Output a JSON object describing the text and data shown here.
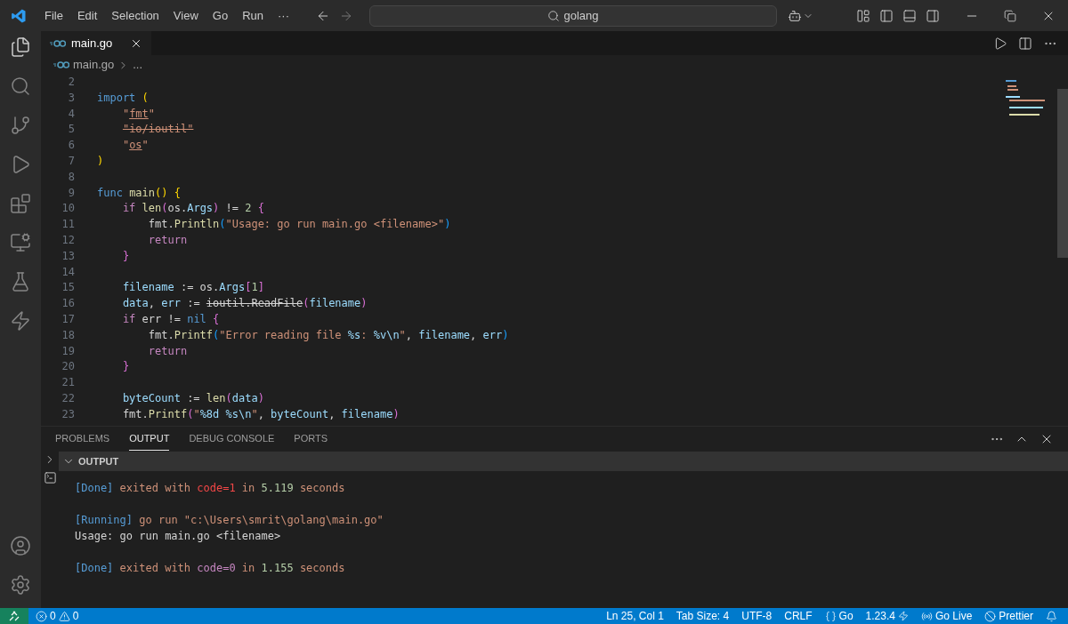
{
  "menu": [
    "File",
    "Edit",
    "Selection",
    "View",
    "Go",
    "Run",
    "···"
  ],
  "command_center": {
    "label": "golang"
  },
  "tabs": [
    {
      "label": "main.go",
      "selected": true
    }
  ],
  "breadcrumbs": [
    "main.go",
    "..."
  ],
  "code_lines": [
    {
      "number": "2"
    },
    {
      "number": "3",
      "tokens": [
        {
          "text": "import ",
          "kind": "kw"
        },
        {
          "text": "(",
          "kind": "b1"
        }
      ]
    },
    {
      "number": "4",
      "tokens": [
        {
          "text": "    \"",
          "kind": "str"
        },
        {
          "text": "fmt",
          "kind": "str",
          "underlined": true
        },
        {
          "text": "\"",
          "kind": "str"
        }
      ]
    },
    {
      "number": "5",
      "tokens": [
        {
          "text": "    \"io/ioutil\"",
          "kind": "str",
          "strikethrough": true
        }
      ]
    },
    {
      "number": "6",
      "tokens": [
        {
          "text": "    \"",
          "kind": "str"
        },
        {
          "text": "os",
          "kind": "str",
          "underlined": true
        },
        {
          "text": "\"",
          "kind": "str"
        }
      ]
    },
    {
      "number": "7",
      "tokens": [
        {
          "text": ")",
          "kind": "b1"
        }
      ]
    },
    {
      "number": "8"
    },
    {
      "number": "9",
      "tokens": [
        {
          "text": "func ",
          "kind": "kw"
        },
        {
          "text": "main",
          "kind": "fn"
        },
        {
          "text": "() {",
          "kind": "b1"
        }
      ]
    },
    {
      "number": "10",
      "tokens": [
        {
          "text": "    if ",
          "kind": "ctrl"
        },
        {
          "text": "len",
          "kind": "fn"
        },
        {
          "text": "(",
          "kind": "b2"
        },
        {
          "text": "os.",
          "kind": "plain"
        },
        {
          "text": "Args",
          "kind": "var"
        },
        {
          "text": ")",
          "kind": "b2"
        },
        {
          "text": " != ",
          "kind": "plain"
        },
        {
          "text": "2 ",
          "kind": "num"
        },
        {
          "text": "{",
          "kind": "b2"
        }
      ]
    },
    {
      "number": "11",
      "tokens": [
        {
          "text": "        fmt.",
          "kind": "plain"
        },
        {
          "text": "Println",
          "kind": "fn"
        },
        {
          "text": "(",
          "kind": "b3"
        },
        {
          "text": "\"Usage: go run main.go <filename>\"",
          "kind": "str"
        },
        {
          "text": ")",
          "kind": "b3"
        }
      ]
    },
    {
      "number": "12",
      "tokens": [
        {
          "text": "        return",
          "kind": "ctrl"
        }
      ]
    },
    {
      "number": "13",
      "tokens": [
        {
          "text": "    }",
          "kind": "b2"
        }
      ]
    },
    {
      "number": "14"
    },
    {
      "number": "15",
      "tokens": [
        {
          "text": "    filename",
          "kind": "var"
        },
        {
          "text": " := os.",
          "kind": "plain"
        },
        {
          "text": "Args",
          "kind": "var"
        },
        {
          "text": "[",
          "kind": "b2"
        },
        {
          "text": "1",
          "kind": "num"
        },
        {
          "text": "]",
          "kind": "b2"
        }
      ]
    },
    {
      "number": "16",
      "tokens": [
        {
          "text": "    data",
          "kind": "var"
        },
        {
          "text": ", ",
          "kind": "plain"
        },
        {
          "text": "err",
          "kind": "var"
        },
        {
          "text": " := ",
          "kind": "plain"
        },
        {
          "text": "ioutil.ReadFile",
          "kind": "plain",
          "strikethrough": true
        },
        {
          "text": "(",
          "kind": "b2"
        },
        {
          "text": "filename",
          "kind": "var"
        },
        {
          "text": ")",
          "kind": "b2"
        }
      ]
    },
    {
      "number": "17",
      "tokens": [
        {
          "text": "    if ",
          "kind": "ctrl"
        },
        {
          "text": "err != ",
          "kind": "plain"
        },
        {
          "text": "nil ",
          "kind": "kw"
        },
        {
          "text": "{",
          "kind": "b2"
        }
      ]
    },
    {
      "number": "18",
      "tokens": [
        {
          "text": "        fmt.",
          "kind": "plain"
        },
        {
          "text": "Printf",
          "kind": "fn"
        },
        {
          "text": "(",
          "kind": "b3"
        },
        {
          "text": "\"Error reading file ",
          "kind": "str"
        },
        {
          "text": "%s",
          "kind": "var"
        },
        {
          "text": ": ",
          "kind": "str"
        },
        {
          "text": "%v\\n",
          "kind": "var"
        },
        {
          "text": "\"",
          "kind": "str"
        },
        {
          "text": ", ",
          "kind": "plain"
        },
        {
          "text": "filename",
          "kind": "var"
        },
        {
          "text": ", ",
          "kind": "plain"
        },
        {
          "text": "err",
          "kind": "var"
        },
        {
          "text": ")",
          "kind": "b3"
        }
      ]
    },
    {
      "number": "19",
      "tokens": [
        {
          "text": "        return",
          "kind": "ctrl"
        }
      ]
    },
    {
      "number": "20",
      "tokens": [
        {
          "text": "    }",
          "kind": "b2"
        }
      ]
    },
    {
      "number": "21"
    },
    {
      "number": "22",
      "tokens": [
        {
          "text": "    byteCount",
          "kind": "var"
        },
        {
          "text": " := ",
          "kind": "plain"
        },
        {
          "text": "len",
          "kind": "fn"
        },
        {
          "text": "(",
          "kind": "b2"
        },
        {
          "text": "data",
          "kind": "var"
        },
        {
          "text": ")",
          "kind": "b2"
        }
      ]
    },
    {
      "number": "23",
      "tokens": [
        {
          "text": "    fmt.",
          "kind": "plain"
        },
        {
          "text": "Printf",
          "kind": "fn"
        },
        {
          "text": "(",
          "kind": "b2"
        },
        {
          "text": "\"",
          "kind": "str"
        },
        {
          "text": "%8d %s\\n",
          "kind": "var"
        },
        {
          "text": "\"",
          "kind": "str"
        },
        {
          "text": ", ",
          "kind": "plain"
        },
        {
          "text": "byteCount",
          "kind": "var"
        },
        {
          "text": ", ",
          "kind": "plain"
        },
        {
          "text": "filename",
          "kind": "var"
        },
        {
          "text": ")",
          "kind": "b2"
        }
      ]
    }
  ],
  "panel": {
    "tabs": [
      {
        "label": "PROBLEMS",
        "selected": false
      },
      {
        "label": "OUTPUT",
        "selected": true
      },
      {
        "label": "DEBUG CONSOLE",
        "selected": false
      },
      {
        "label": "PORTS",
        "selected": false
      }
    ],
    "section": {
      "label": "OUTPUT",
      "expanded": true
    },
    "output_lines": [
      {
        "tokens": [
          {
            "text": "[Done]",
            "kind": "tag"
          },
          {
            "text": " exited with ",
            "kind": "str"
          },
          {
            "text": "code=1",
            "kind": "err"
          },
          {
            "text": " in ",
            "kind": "str"
          },
          {
            "text": "5.119",
            "kind": "num"
          },
          {
            "text": " seconds",
            "kind": "str"
          }
        ]
      },
      {
        "spaced": true,
        "tokens": [
          {
            "text": "[Running]",
            "kind": "tag"
          },
          {
            "text": " go run \"c:\\Users\\smrit\\golang\\main.go\"",
            "kind": "str"
          }
        ]
      },
      {
        "tokens": [
          {
            "text": "Usage: go run main.go <filename>",
            "kind": "plain"
          }
        ]
      },
      {
        "spaced": true,
        "tokens": [
          {
            "text": "[Done]",
            "kind": "tag"
          },
          {
            "text": " exited with ",
            "kind": "str"
          },
          {
            "text": "code=0",
            "kind": "ok"
          },
          {
            "text": " in ",
            "kind": "str"
          },
          {
            "text": "1.155",
            "kind": "num"
          },
          {
            "text": " seconds",
            "kind": "str"
          }
        ]
      }
    ]
  },
  "status_bar": {
    "errors": "0",
    "warnings": "0",
    "items": [
      {
        "kind": "text",
        "label": "Ln 25, Col 1"
      },
      {
        "kind": "text",
        "label": "Tab Size: 4"
      },
      {
        "kind": "text",
        "label": "UTF-8"
      },
      {
        "kind": "text",
        "label": "CRLF"
      },
      {
        "kind": "language",
        "label": "Go"
      },
      {
        "kind": "version",
        "label": "1.23.4"
      },
      {
        "kind": "live",
        "label": "Go Live"
      },
      {
        "kind": "formatter",
        "label": "Prettier"
      }
    ]
  }
}
